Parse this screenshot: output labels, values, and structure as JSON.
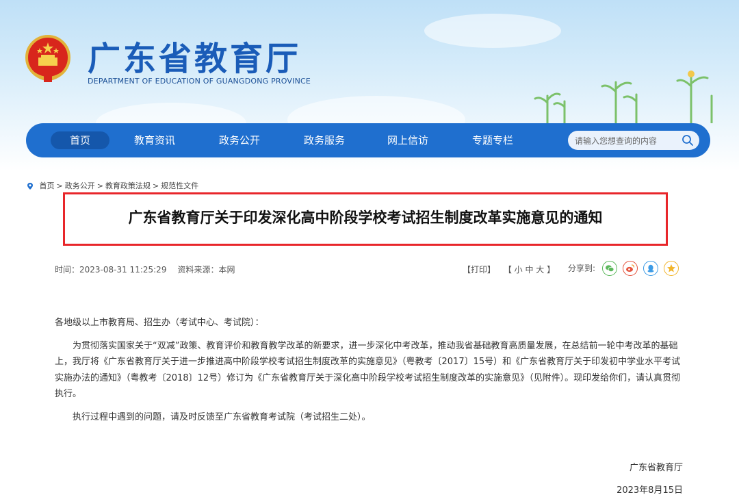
{
  "site": {
    "title": "广东省教育厅",
    "subtitle": "DEPARTMENT OF EDUCATION OF GUANGDONG PROVINCE"
  },
  "nav": {
    "items": [
      "首页",
      "教育资讯",
      "政务公开",
      "政务服务",
      "网上信访",
      "专题专栏"
    ],
    "active": "首页",
    "search_placeholder": "请输入您想查询的内容"
  },
  "breadcrumb": [
    "首页",
    "政务公开",
    "教育政策法规",
    "规范性文件"
  ],
  "breadcrumb_sep": ">",
  "article": {
    "title": "广东省教育厅关于印发深化高中阶段学校考试招生制度改革实施意见的通知",
    "time": "时间：2023-08-31 11:25:29",
    "source": "资料来源：本网",
    "print": "【打印】",
    "font_size": "【 小  中  大 】",
    "share_label": "分享到:",
    "share_icons": [
      "wechat-icon",
      "weibo-icon",
      "qq-icon",
      "qzone-icon"
    ],
    "paragraphs": [
      "各地级以上市教育局、招生办（考试中心、考试院）：",
      "为贯彻落实国家关于“双减”政策、教育评价和教育教学改革的新要求，进一步深化中考改革，推动我省基础教育高质量发展，在总结前一轮中考改革的基础上，我厅将《广东省教育厅关于进一步推进高中阶段学校考试招生制度改革的实施意见》（粤教考〔2017〕15号）和《广东省教育厅关于印发初中学业水平考试实施办法的通知》（粤教考〔2018〕12号）修订为《广东省教育厅关于深化高中阶段学校考试招生制度改革的实施意见》（见附件）。现印发给你们，请认真贯彻执行。",
      "执行过程中遇到的问题，请及时反馈至广东省教育考试院（考试招生二处）。"
    ],
    "signature": "广东省教育厅",
    "date": "2023年8月15日"
  },
  "colors": {
    "brand_blue": "#1f6fcf",
    "title_text": "#1a5cb8",
    "highlight_border": "#e8262a"
  }
}
